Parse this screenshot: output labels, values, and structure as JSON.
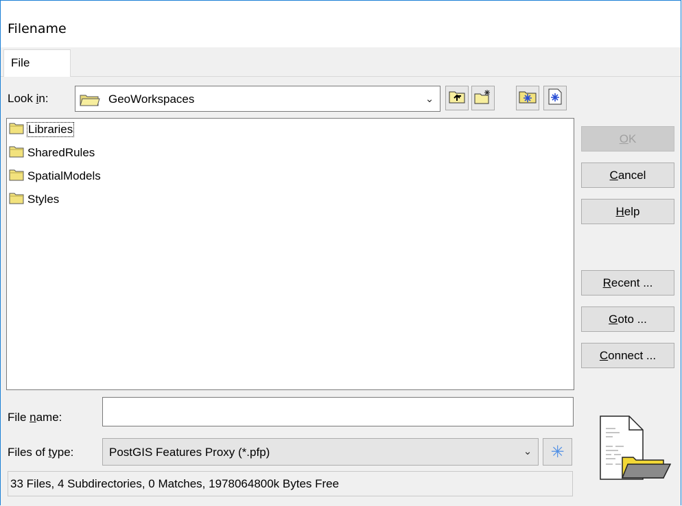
{
  "window": {
    "title": "Filename"
  },
  "tabs": [
    {
      "label": "File"
    }
  ],
  "look_in": {
    "label_pre": "Look ",
    "label_u": "i",
    "label_post": "n:",
    "value": "GeoWorkspaces",
    "toolbar_icons": [
      "up-folder-icon",
      "new-folder-icon",
      "connect-icon",
      "new-file-icon"
    ]
  },
  "file_list": {
    "items": [
      {
        "name": "Libraries",
        "icon": "folder-icon"
      },
      {
        "name": "SharedRules",
        "icon": "folder-icon"
      },
      {
        "name": "SpatialModels",
        "icon": "folder-icon"
      },
      {
        "name": "Styles",
        "icon": "folder-icon"
      }
    ]
  },
  "buttons": {
    "ok": {
      "u": "O",
      "rest": "K"
    },
    "cancel": {
      "u": "C",
      "rest": "ancel"
    },
    "help": {
      "u": "H",
      "rest": "elp"
    },
    "recent": {
      "u": "R",
      "rest": "ecent ..."
    },
    "goto": {
      "u": "G",
      "rest": "oto ..."
    },
    "connect": {
      "u": "C",
      "rest": "onnect ..."
    }
  },
  "file_name": {
    "label_pre": "File ",
    "label_u": "n",
    "label_post": "ame:",
    "value": ""
  },
  "file_type": {
    "label_pre": "Files of ",
    "label_u": "t",
    "label_post": "ype:",
    "value": "PostGIS Features Proxy (*.pfp)"
  },
  "status": "33 Files, 4 Subdirectories, 0 Matches, 1978064800k Bytes Free",
  "colors": {
    "accent": "#1a7fd6",
    "folder": "#f2e27d"
  }
}
